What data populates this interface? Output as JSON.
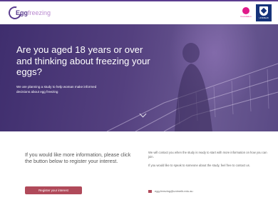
{
  "header": {
    "logo_primary": "Egg",
    "logo_secondary": "freezing",
    "partner1_caption": "Foundation",
    "partner2_caption": "UNIMELB"
  },
  "hero": {
    "title": "Are you aged 18 years or over and thinking about freezing your eggs?",
    "subtitle": "We are planning a study to help woman make informed decisions about egg freezing",
    "scroll_icon": "chevron-down-icon"
  },
  "info": {
    "left_text": "If you would like more information, please click the button below to register your interest.",
    "register_button": "Register your interest",
    "right_p1": "We will contact you when the study is ready to start with more information on how you can join.",
    "right_p2": "If you would like to speak to someone about the study, feel free to contact us.",
    "email": "egg-freezing@unimelb.edu.au",
    "email_icon": "envelope-icon"
  },
  "colors": {
    "brand_purple": "#5b3d8f",
    "accent_red": "#b04a5a"
  }
}
